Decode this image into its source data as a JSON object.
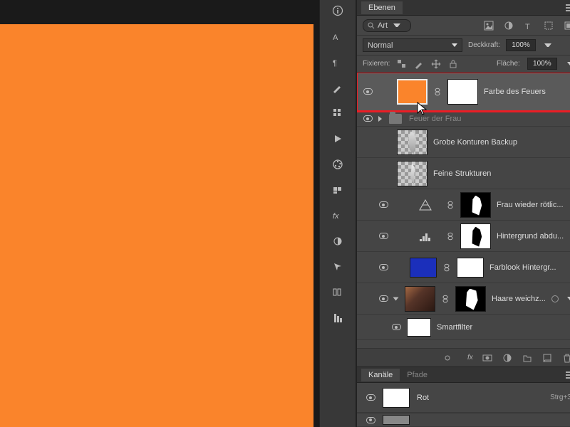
{
  "panel": {
    "layers_tab": "Ebenen",
    "channels_tab": "Kanäle",
    "paths_tab": "Pfade"
  },
  "search": {
    "kind": "Art"
  },
  "blend": {
    "mode": "Normal",
    "opacity_label": "Deckkraft:",
    "opacity": "100%",
    "fill_label": "Fläche:",
    "fill": "100%"
  },
  "lock": {
    "label": "Fixieren:"
  },
  "layers": [
    {
      "name": "Farbe des Feuers"
    },
    {
      "name": "Feuer der Frau"
    },
    {
      "name": "Grobe Konturen Backup"
    },
    {
      "name": "Feine Strukturen"
    },
    {
      "name": "Frau wieder rötlic..."
    },
    {
      "name": "Hintergrund abdu..."
    },
    {
      "name": "Farblook Hintergr..."
    },
    {
      "name": "Haare weichz..."
    },
    {
      "name": "Smartfilter"
    }
  ],
  "bottom_fx": "fx",
  "channels": [
    {
      "name": "Rot",
      "short": "Strg+3"
    }
  ],
  "colors": {
    "canvas": "#fa842b",
    "solid": "#fa842b",
    "blue": "#1b2fbb"
  }
}
